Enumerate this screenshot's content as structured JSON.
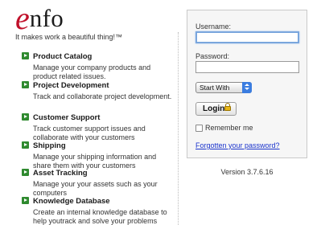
{
  "logo": {
    "first_letter": "e",
    "rest": "nfo"
  },
  "tagline": "It makes work a beautiful thing!™",
  "features": [
    {
      "title": "Product Catalog",
      "desc": "Manage your company products and product related issues."
    },
    {
      "title": "Project Development",
      "desc": "Track and collaborate project development."
    },
    {
      "title": "Customer Support",
      "desc": "Track customer support issues and collaborate with your customers"
    },
    {
      "title": "Shipping",
      "desc": "Manage your shipping information and share them with your customers"
    },
    {
      "title": "Asset Tracking",
      "desc": "Manage your your assets such as your computers"
    },
    {
      "title": "Knowledge Database",
      "desc": "Create an internal knowledge database to help youtrack and solve your problems"
    }
  ],
  "login": {
    "username_label": "Username:",
    "username_value": "",
    "password_label": "Password:",
    "password_value": "",
    "start_with": {
      "selected": "Start With"
    },
    "login_button": "Login",
    "remember_label": "Remember me",
    "remember_checked": false,
    "forgot_link": "Forgotten your password?"
  },
  "version": "Version 3.7.6.16",
  "colors": {
    "brand_e": "#c0102a",
    "feature_arrow": "#2f8a2f",
    "link": "#1a33cc",
    "focus_ring": "#7aa6dd"
  },
  "icons": {
    "feature_bullet": "green-arrow-icon",
    "login_lock": "lock-icon",
    "select_arrows": "up-down-arrows-icon"
  }
}
